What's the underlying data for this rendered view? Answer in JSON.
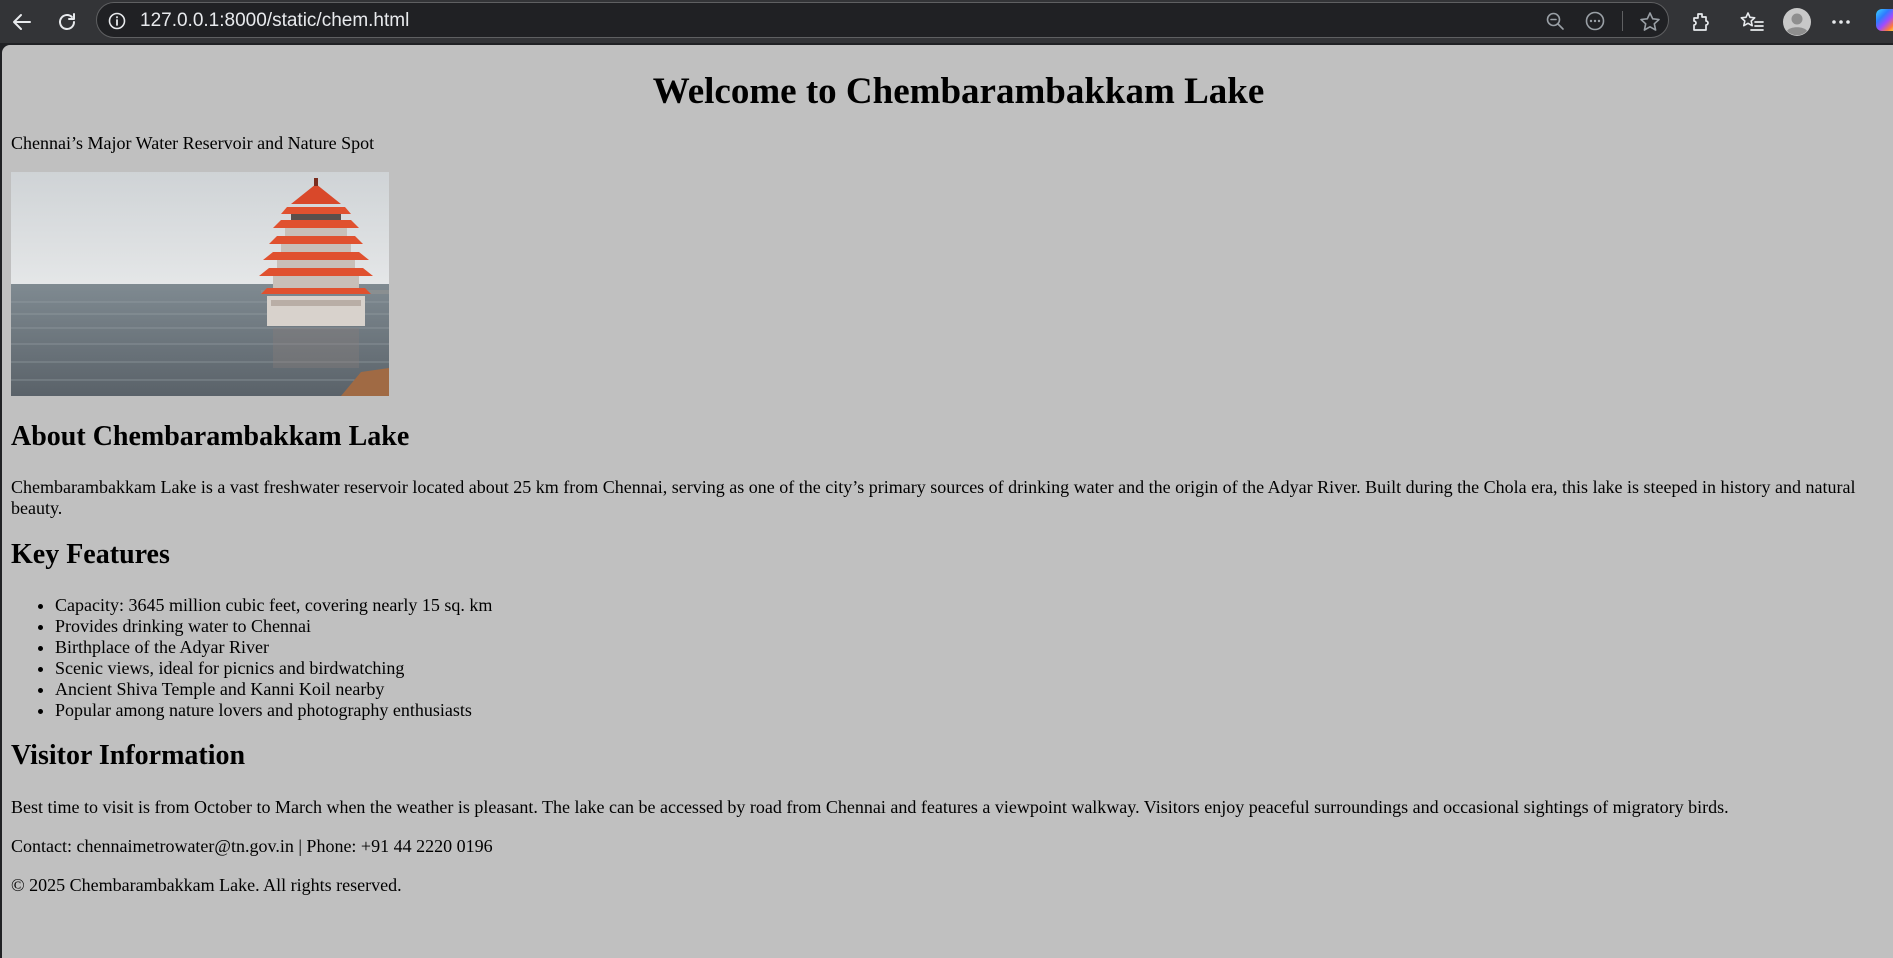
{
  "browser": {
    "url": "127.0.0.1:8000/static/chem.html",
    "icons": [
      "back-icon",
      "refresh-icon",
      "site-info-icon",
      "zoom-out-icon",
      "read-aloud-icon",
      "favorite-star-icon",
      "extensions-icon",
      "favorites-icon",
      "profile-avatar-icon",
      "more-icon",
      "copilot-icon"
    ]
  },
  "page": {
    "title": "Welcome to Chembarambakkam Lake",
    "tagline": "Chennai’s Major Water Reservoir and Nature Spot",
    "about_heading": "About Chembarambakkam Lake",
    "about_text": "Chembarambakkam Lake is a vast freshwater reservoir located about 25 km from Chennai, serving as one of the city’s primary sources of drinking water and the origin of the Adyar River. Built during the Chola era, this lake is steeped in history and natural beauty.",
    "features_heading": "Key Features",
    "features": [
      "Capacity: 3645 million cubic feet, covering nearly 15 sq. km",
      "Provides drinking water to Chennai",
      "Birthplace of the Adyar River",
      "Scenic views, ideal for picnics and birdwatching",
      "Ancient Shiva Temple and Kanni Koil nearby",
      "Popular among nature lovers and photography enthusiasts"
    ],
    "visitor_heading": "Visitor Information",
    "visitor_text": "Best time to visit is from October to March when the weather is pleasant. The lake can be accessed by road from Chennai and features a viewpoint walkway. Visitors enjoy peaceful surroundings and occasional sightings of migratory birds.",
    "contact": "Contact: chennaimetrowater@tn.gov.in | Phone: +91 44 2220 0196",
    "footer": "© 2025 Chembarambakkam Lake. All rights reserved."
  },
  "colors": {
    "page_background": "#c0c0c0",
    "chrome_background": "#333437",
    "pavilion_roof": "#e0512f"
  }
}
